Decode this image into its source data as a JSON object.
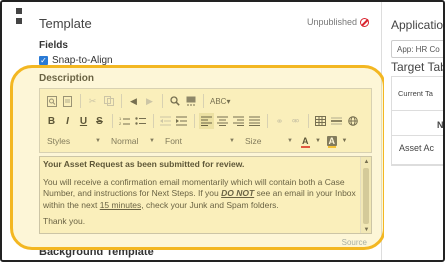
{
  "panel": {
    "title": "Template",
    "status": "Unpublished",
    "fields_label": "Fields",
    "snap_label": "Snap-to-Align",
    "description_label": "Description",
    "source_link": "Source",
    "background_label": "Background Template"
  },
  "toolbar": {
    "styles": "Styles",
    "format": "Normal",
    "font": "Font",
    "size": "Size",
    "bold": "B",
    "italic": "I",
    "underline": "U",
    "strike": "S",
    "text_color": "A",
    "bg_color": "A"
  },
  "editor": {
    "heading": "Your Asset Request as been submitted for review.",
    "para1_start": "You will receive a confirmation email momentarily which will contain both a Case Number, and instructions for Next Steps. If you ",
    "para1_emph": "DO NOT",
    "para1_mid": " see an email in your Inbox within the next ",
    "para1_link": "15 minutes,",
    "para1_end": " check your Junk and Spam folders.",
    "thanks": "Thank you."
  },
  "right_panel": {
    "title": "Application",
    "select_value": "App: HR Co",
    "target_title": "Target Tab",
    "current_tab": "Current Ta",
    "column_header": "Nam",
    "row_value": "Asset Ac"
  },
  "colors": {
    "highlight": "#f3b722",
    "editor_bg": "#fbf6d8",
    "checkbox": "#2a7ad5",
    "unpublished_icon": "#d9232e",
    "text_color_bar": "#d9232e",
    "bg_color_bar": "#f3b722"
  }
}
